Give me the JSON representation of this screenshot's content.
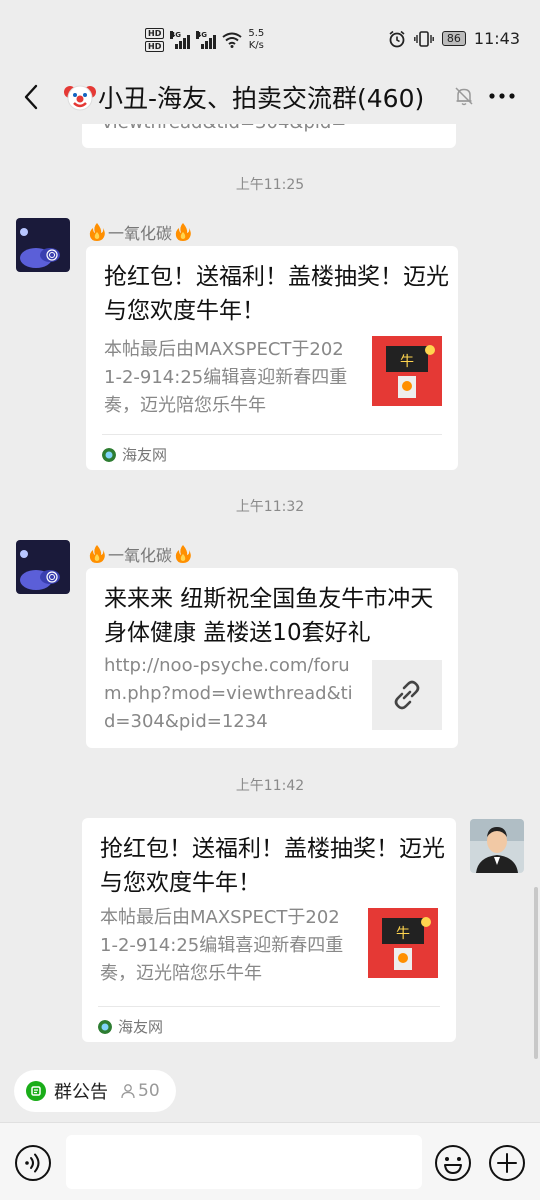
{
  "status_bar": {
    "hd1": "HD",
    "hd2": "HD",
    "net1": "4G",
    "net2": "4G",
    "speed_value": "5.5",
    "speed_unit": "K/s",
    "battery": "86",
    "time": "11:43"
  },
  "header": {
    "title": "小丑-海友、拍卖交流群(460)"
  },
  "chat": {
    "partial_text": "viewthread&tid=304&pid=",
    "messages": [
      {
        "time": "上午11:25",
        "sender": "一氧化碳",
        "title": "抢红包！送福利！盖楼抽奖！迈光与您欢度牛年！",
        "desc": "本帖最后由MAXSPECT于2021-2-914:25编辑喜迎新春四重奏，迈光陪您乐牛年",
        "source": "海友网"
      },
      {
        "time": "上午11:32",
        "sender": "一氧化碳",
        "title": "来来来 纽斯祝全国鱼友牛市冲天 身体健康 盖楼送10套好礼",
        "desc": "http://noo-psyche.com/forum.php?mod=viewthread&tid=304&pid=1234"
      },
      {
        "time": "上午11:42",
        "title": "抢红包！送福利！盖楼抽奖！迈光与您欢度牛年！",
        "desc": "本帖最后由MAXSPECT于2021-2-914:25编辑喜迎新春四重奏，迈光陪您乐牛年",
        "source": "海友网"
      }
    ]
  },
  "group_notice": {
    "label": "群公告",
    "count": "50"
  },
  "input": {
    "placeholder": ""
  },
  "colors": {
    "accent_green": "#1aad19",
    "background": "#ededed"
  },
  "icons": [
    "back-arrow-icon",
    "clown-emoji-icon",
    "mute-bell-icon",
    "more-dots-icon",
    "fire-icon",
    "haiyou-source-icon",
    "link-icon",
    "notice-icon",
    "person-icon",
    "voice-icon",
    "emoji-icon",
    "plus-icon"
  ]
}
